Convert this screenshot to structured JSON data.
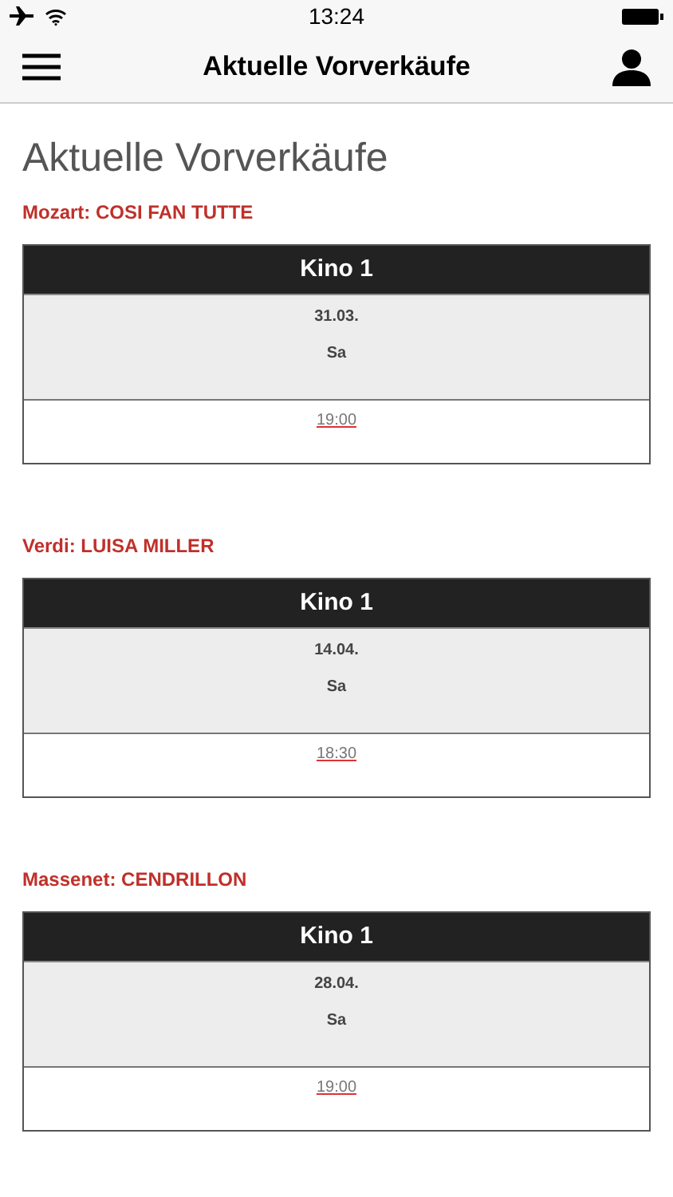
{
  "status_bar": {
    "time": "13:24"
  },
  "nav_bar": {
    "title": "Aktuelle Vorverkäufe"
  },
  "page_title": "Aktuelle Vorverkäufe",
  "events": [
    {
      "title": "Mozart: COSI FAN TUTTE",
      "venue": "Kino 1",
      "date": "31.03.",
      "weekday": "Sa",
      "time": "19:00"
    },
    {
      "title": "Verdi: LUISA MILLER",
      "venue": "Kino 1",
      "date": "14.04.",
      "weekday": "Sa",
      "time": "18:30"
    },
    {
      "title": "Massenet: CENDRILLON",
      "venue": "Kino 1",
      "date": "28.04.",
      "weekday": "Sa",
      "time": "19:00"
    }
  ]
}
